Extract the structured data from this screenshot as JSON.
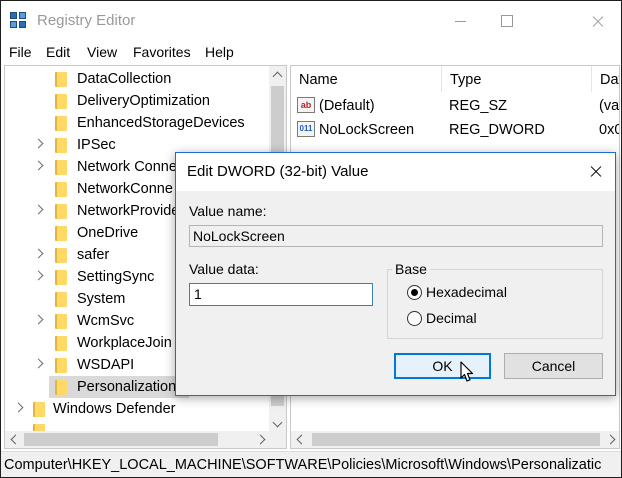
{
  "window": {
    "title": "Registry Editor",
    "icon": "registry-editor-icon"
  },
  "menu": [
    "File",
    "Edit",
    "View",
    "Favorites",
    "Help"
  ],
  "tree": {
    "items": [
      {
        "label": "DataCollection",
        "expandable": false
      },
      {
        "label": "DeliveryOptimization",
        "expandable": false
      },
      {
        "label": "EnhancedStorageDevices",
        "expandable": false
      },
      {
        "label": "IPSec",
        "expandable": true
      },
      {
        "label": "Network Conne",
        "expandable": true
      },
      {
        "label": "NetworkConne",
        "expandable": false
      },
      {
        "label": "NetworkProvide",
        "expandable": true
      },
      {
        "label": "OneDrive",
        "expandable": false
      },
      {
        "label": "safer",
        "expandable": true
      },
      {
        "label": "SettingSync",
        "expandable": true
      },
      {
        "label": "System",
        "expandable": false
      },
      {
        "label": "WcmSvc",
        "expandable": true
      },
      {
        "label": "WorkplaceJoin",
        "expandable": false
      },
      {
        "label": "WSDAPI",
        "expandable": true
      },
      {
        "label": "Personalization",
        "expandable": false,
        "selected": true
      }
    ],
    "parent_item": {
      "label": "Windows Defender",
      "expandable": true
    }
  },
  "values": {
    "columns": [
      "Name",
      "Type",
      "Dat"
    ],
    "rows": [
      {
        "icon": "string-value-icon",
        "name": "(Default)",
        "type": "REG_SZ",
        "data": "(va"
      },
      {
        "icon": "binary-value-icon",
        "name": "NoLockScreen",
        "type": "REG_DWORD",
        "data": "0x0"
      }
    ]
  },
  "status_bar": "Computer\\HKEY_LOCAL_MACHINE\\SOFTWARE\\Policies\\Microsoft\\Windows\\Personalizatic",
  "dialog": {
    "title": "Edit DWORD (32-bit) Value",
    "value_name_label": "Value name:",
    "value_name": "NoLockScreen",
    "value_data_label": "Value data:",
    "value_data": "1",
    "base_label": "Base",
    "base_options": [
      "Hexadecimal",
      "Decimal"
    ],
    "base_selected": "Hexadecimal",
    "ok_label": "OK",
    "cancel_label": "Cancel"
  },
  "colors": {
    "accent": "#0078d7",
    "folder": "#ffd966",
    "selection": "#d9d9d9"
  }
}
